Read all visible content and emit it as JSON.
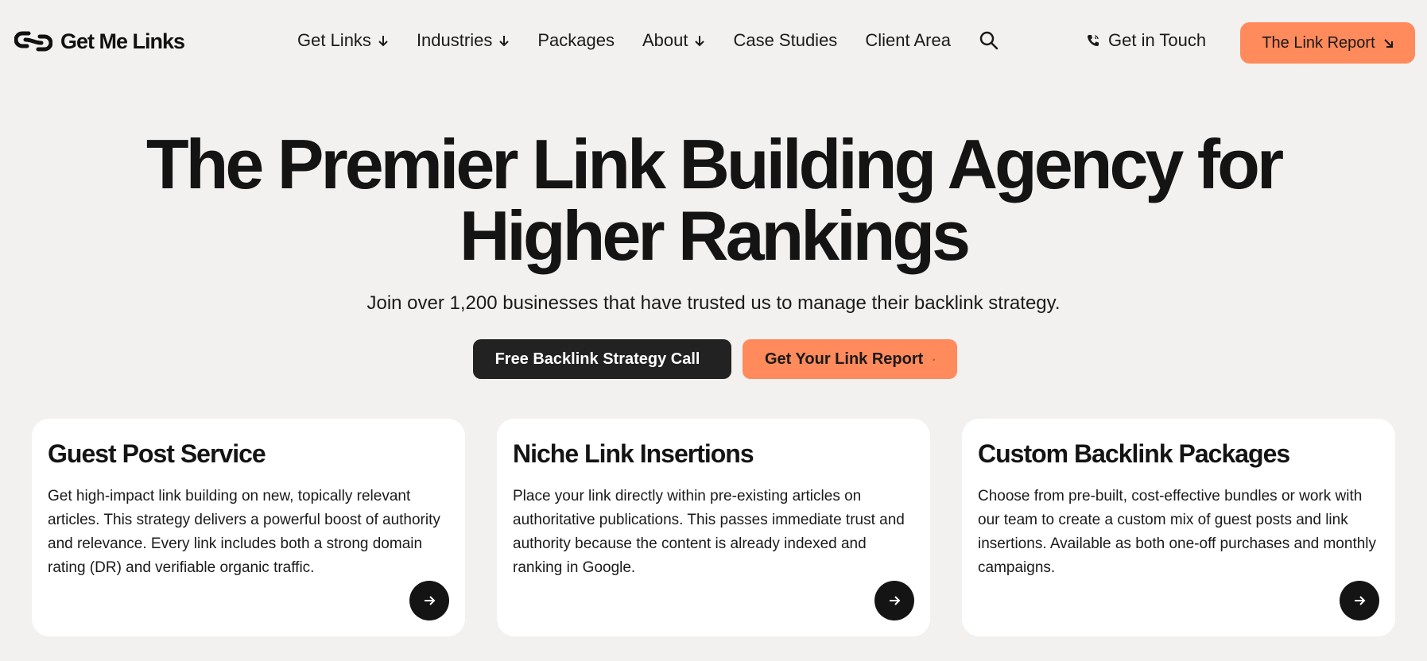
{
  "header": {
    "logo_text": "Get Me Links",
    "nav": [
      {
        "label": "Get Links",
        "dropdown": true
      },
      {
        "label": "Industries",
        "dropdown": true
      },
      {
        "label": "Packages",
        "dropdown": false
      },
      {
        "label": "About",
        "dropdown": true
      },
      {
        "label": "Case Studies",
        "dropdown": false
      },
      {
        "label": "Client Area",
        "dropdown": false
      }
    ],
    "contact_label": "Get in Touch",
    "report_button_label": "The Link Report"
  },
  "hero": {
    "title_line1": "The Premier Link Building Agency for",
    "title_line2": "Higher Rankings",
    "subtitle": "Join over 1,200 businesses that have trusted us to manage their backlink strategy.",
    "cta_primary": "Free Backlink Strategy Call",
    "cta_secondary": "Get Your Link Report"
  },
  "cards": [
    {
      "title": "Guest Post Service",
      "body": "Get high-impact link building on new, topically relevant articles. This strategy delivers a powerful boost of authority and relevance. Every link includes both a strong domain rating (DR) and verifiable organic traffic."
    },
    {
      "title": "Niche Link Insertions",
      "body": "Place your link directly within pre-existing articles on authoritative publications. This passes immediate trust and authority because the content is already indexed and ranking in Google."
    },
    {
      "title": "Custom Backlink Packages",
      "body": "Choose from pre-built, cost-effective bundles or work with our team to create a custom mix of guest posts and link insertions. Available as both one-off purchases and monthly campaigns."
    }
  ],
  "colors": {
    "background": "#f2f1ef",
    "accent": "#ff8a5b",
    "dark": "#222222"
  },
  "icons": {
    "logo": "chain-link-icon",
    "dropdown": "arrow-down-icon",
    "search": "search-icon",
    "phone": "phone-icon",
    "cta": "arrow-down-right-icon",
    "card": "arrow-right-icon"
  }
}
